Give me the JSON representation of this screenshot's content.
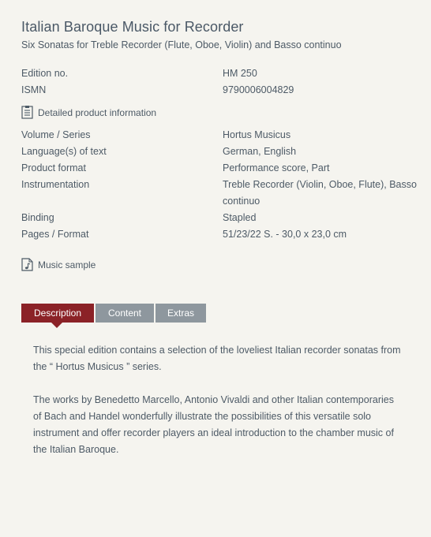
{
  "header": {
    "title": "Italian Baroque Music for Recorder",
    "subtitle": "Six Sonatas for Treble Recorder (Flute, Oboe, Violin) and Basso continuo"
  },
  "edition": {
    "edition_label": "Edition no.",
    "edition_value": "HM 250",
    "ismn_label": "ISMN",
    "ismn_value": "9790006004829"
  },
  "product_info_link": {
    "label": "Detailed product information",
    "icon": "document-list-icon"
  },
  "details": {
    "volume_label": "Volume / Series",
    "volume_value": "Hortus Musicus",
    "language_label": "Language(s) of text",
    "language_value": "German, English",
    "format_label": "Product format",
    "format_value": "Performance score, Part",
    "instrumentation_label": "Instrumentation",
    "instrumentation_value": "Treble Recorder (Violin, Oboe, Flute), Basso continuo",
    "binding_label": "Binding",
    "binding_value": "Stapled",
    "pages_label": "Pages / Format",
    "pages_value": "51/23/22 S. - 30,0 x 23,0 cm"
  },
  "music_sample_link": {
    "label": "Music sample",
    "icon": "music-note-document-icon"
  },
  "tabs": [
    {
      "label": "Description",
      "active": true
    },
    {
      "label": "Content",
      "active": false
    },
    {
      "label": "Extras",
      "active": false
    }
  ],
  "description": {
    "paragraph_1": "This special edition contains a selection of the loveliest Italian recorder sonatas from the “ Hortus Musicus ” series.",
    "paragraph_2": "The works by Benedetto Marcello, Antonio Vivaldi and other Italian contemporaries of Bach and Handel wonderfully illustrate the possibilities of this versatile solo instrument and offer recorder players an ideal introduction to the chamber music of the Italian Baroque."
  },
  "colors": {
    "background": "#f5f4ef",
    "text": "#4d5a66",
    "tab_active": "#8b2227",
    "tab_inactive": "#8e979e"
  }
}
